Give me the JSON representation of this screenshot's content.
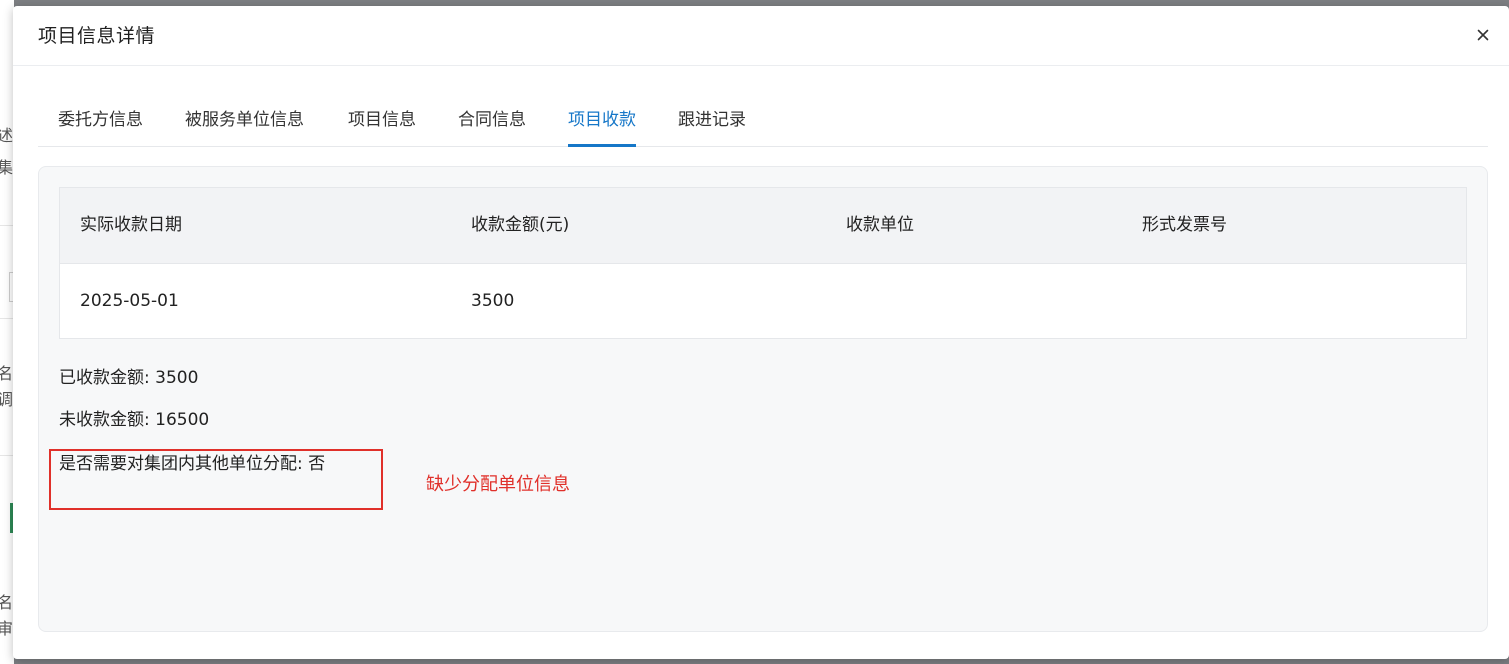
{
  "dialog": {
    "title": "项目信息详情",
    "close_icon": "close-icon"
  },
  "tabs": [
    {
      "label": "委托方信息",
      "active": false
    },
    {
      "label": "被服务单位信息",
      "active": false
    },
    {
      "label": "项目信息",
      "active": false
    },
    {
      "label": "合同信息",
      "active": false
    },
    {
      "label": "项目收款",
      "active": true
    },
    {
      "label": "跟进记录",
      "active": false
    }
  ],
  "payments_table": {
    "columns": [
      "实际收款日期",
      "收款金额(元)",
      "收款单位",
      "形式发票号"
    ],
    "rows": [
      [
        "2025-05-01",
        "3500",
        "",
        ""
      ]
    ]
  },
  "summary": {
    "received": "已收款金额: 3500",
    "unreceived": "未收款金额: 16500",
    "allocation": "是否需要对集团内其他单位分配: 否"
  },
  "annotation": {
    "text": "缺少分配单位信息",
    "color": "#e0302a"
  },
  "backdrop": {
    "fragments": [
      "述",
      "集",
      "名",
      "调",
      "名",
      "审"
    ]
  },
  "colors": {
    "accent": "#1677c8",
    "overlay": "#7d7f83",
    "annotation": "#e0302a"
  }
}
